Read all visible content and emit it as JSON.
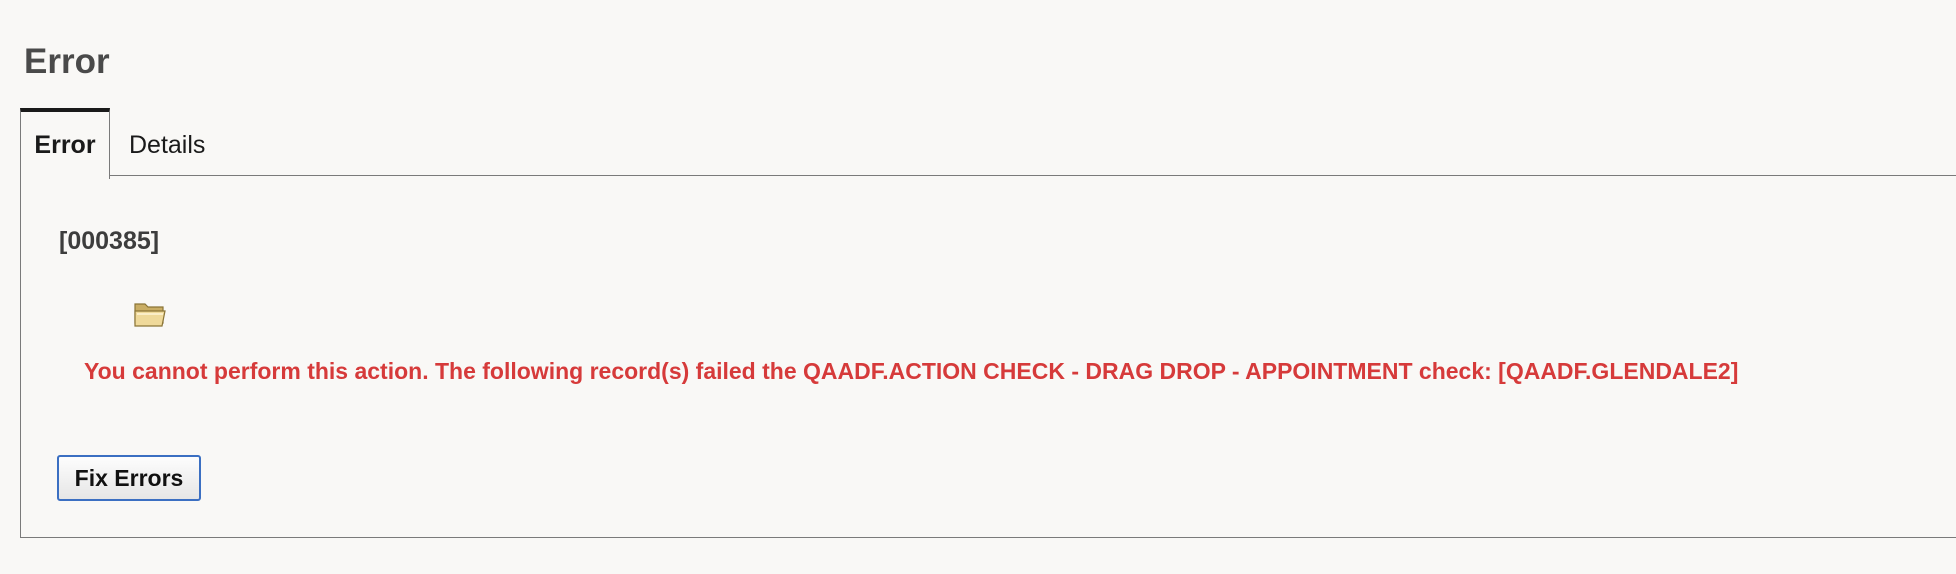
{
  "page": {
    "title": "Error"
  },
  "tabs": [
    {
      "label": "Error",
      "active": true
    },
    {
      "label": "Details",
      "active": false
    }
  ],
  "error": {
    "code": "[000385]",
    "icon": "folder-open-icon",
    "message": "You cannot perform this action. The following record(s) failed the QAADF.ACTION CHECK - DRAG DROP - APPOINTMENT check: [QAADF.GLENDALE2]",
    "message_color": "#d63a3a"
  },
  "actions": {
    "fix_errors_label": "Fix Errors"
  },
  "colors": {
    "background": "#f9f8f6",
    "accent_border": "#3b6fc2"
  }
}
